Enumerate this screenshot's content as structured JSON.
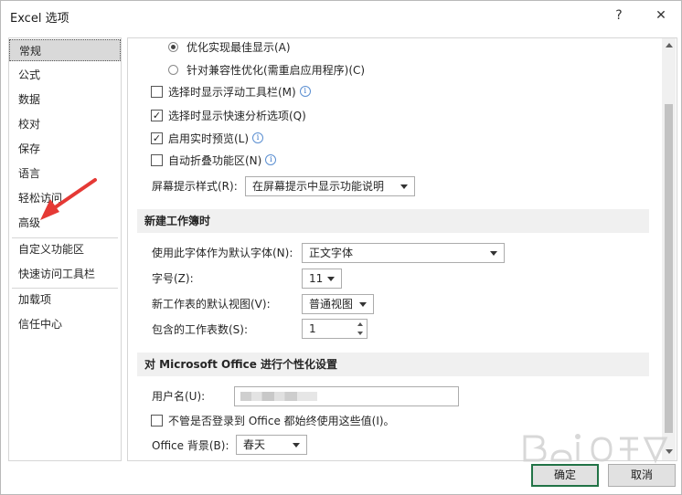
{
  "window": {
    "title": "Excel 选项",
    "help_label": "?",
    "close_label": "✕"
  },
  "sidebar": {
    "items": [
      {
        "label": "常规",
        "selected": true
      },
      {
        "label": "公式"
      },
      {
        "label": "数据"
      },
      {
        "label": "校对"
      },
      {
        "label": "保存"
      },
      {
        "label": "语言"
      },
      {
        "label": "轻松访问"
      },
      {
        "label": "高级"
      },
      {
        "label": "自定义功能区"
      },
      {
        "label": "快速访问工具栏"
      },
      {
        "label": "加载项"
      },
      {
        "label": "信任中心"
      }
    ]
  },
  "ui_options": {
    "radio_optimize_display": "优化实现最佳显示(A)",
    "radio_optimize_compat": "针对兼容性优化(需重启应用程序)(C)",
    "show_mini_toolbar": "选择时显示浮动工具栏(M)",
    "show_mini_toolbar_checked": false,
    "show_quick_analysis": "选择时显示快速分析选项(Q)",
    "show_quick_analysis_checked": true,
    "live_preview": "启用实时预览(L)",
    "live_preview_checked": true,
    "collapse_ribbon": "自动折叠功能区(N)",
    "collapse_ribbon_checked": false,
    "screentip_label": "屏幕提示样式(R):",
    "screentip_value": "在屏幕提示中显示功能说明",
    "info_glyph": "i",
    "check_glyph": "✓"
  },
  "new_workbook": {
    "header": "新建工作簿时",
    "font_label": "使用此字体作为默认字体(N):",
    "font_value": "正文字体",
    "size_label": "字号(Z):",
    "size_value": "11",
    "view_label": "新工作表的默认视图(V):",
    "view_value": "普通视图",
    "sheets_label": "包含的工作表数(S):",
    "sheets_value": "1"
  },
  "personalize": {
    "header": "对 Microsoft Office 进行个性化设置",
    "username_label": "用户名(U):",
    "always_use_label": "不管是否登录到 Office 都始终使用这些值(I)。",
    "always_use_checked": false,
    "background_label": "Office 背景(B):",
    "background_value": "春天"
  },
  "footer": {
    "ok_label": "确定",
    "cancel_label": "取消"
  },
  "colors": {
    "accent_green": "#217346",
    "annotation_red": "#e53935"
  }
}
